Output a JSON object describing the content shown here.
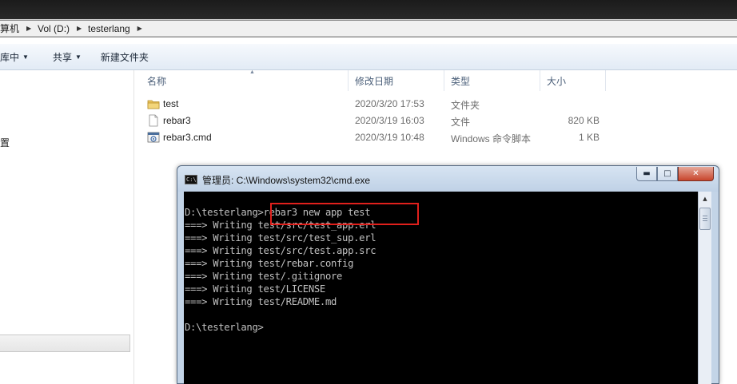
{
  "explorer": {
    "breadcrumbs": [
      "算机",
      "Vol (D:)",
      "testerlang"
    ],
    "toolbar": [
      "库中",
      "共享",
      "新建文件夹"
    ],
    "nav_partial_label": "置",
    "columns": [
      "名称",
      "修改日期",
      "类型",
      "大小"
    ],
    "files": [
      {
        "name": "test",
        "date": "2020/3/20 17:53",
        "type": "文件夹",
        "size": "",
        "icon": "folder-icon"
      },
      {
        "name": "rebar3",
        "date": "2020/3/19 16:03",
        "type": "文件",
        "size": "820 KB",
        "icon": "file-icon"
      },
      {
        "name": "rebar3.cmd",
        "date": "2020/3/19 10:48",
        "type": "Windows 命令脚本",
        "size": "1 KB",
        "icon": "script-icon"
      }
    ]
  },
  "cmd": {
    "title": "管理员: C:\\Windows\\system32\\cmd.exe",
    "app_icon_text": "C:\\",
    "lines": [
      "",
      "D:\\testerlang>rebar3 new app test",
      "===> Writing test/src/test_app.erl",
      "===> Writing test/src/test_sup.erl",
      "===> Writing test/src/test.app.src",
      "===> Writing test/rebar.config",
      "===> Writing test/.gitignore",
      "===> Writing test/LICENSE",
      "===> Writing test/README.md",
      "",
      "D:\\testerlang>"
    ],
    "highlight_color": "#e0201c"
  }
}
